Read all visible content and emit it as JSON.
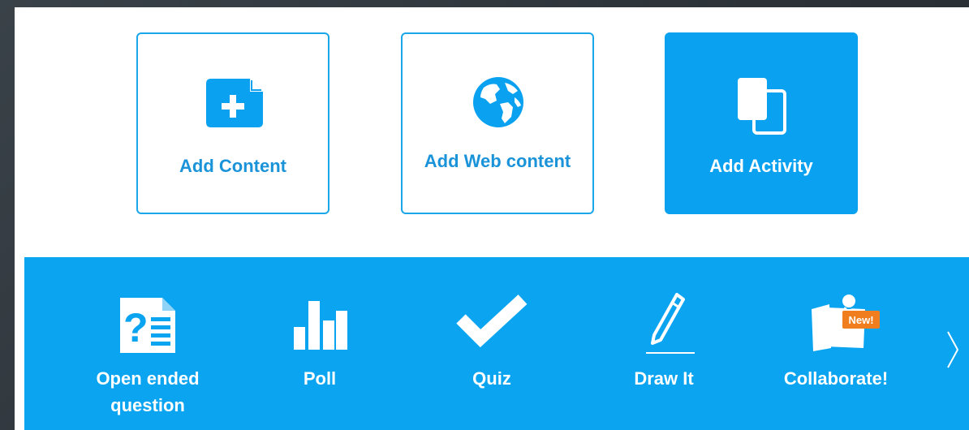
{
  "colors": {
    "accent": "#0aa2f0",
    "accent_text": "#1a93d9",
    "strip_bg": "#0ba4f1",
    "new_badge": "#f07d1e",
    "frame": "#2c3238"
  },
  "cards": [
    {
      "label": "Add Content",
      "icon": "add-document-icon"
    },
    {
      "label": "Add Web content",
      "icon": "globe-icon"
    },
    {
      "label": "Add Activity",
      "icon": "copy-pages-icon",
      "selected": true
    }
  ],
  "activities": [
    {
      "label": "Open ended question",
      "icon": "question-document-icon"
    },
    {
      "label": "Poll",
      "icon": "bar-chart-icon"
    },
    {
      "label": "Quiz",
      "icon": "checkmark-icon"
    },
    {
      "label": "Draw It",
      "icon": "pencil-icon"
    },
    {
      "label": "Collaborate!",
      "icon": "pinned-notes-icon",
      "badge": "New!"
    }
  ],
  "next_icon": "chevron-right-icon"
}
